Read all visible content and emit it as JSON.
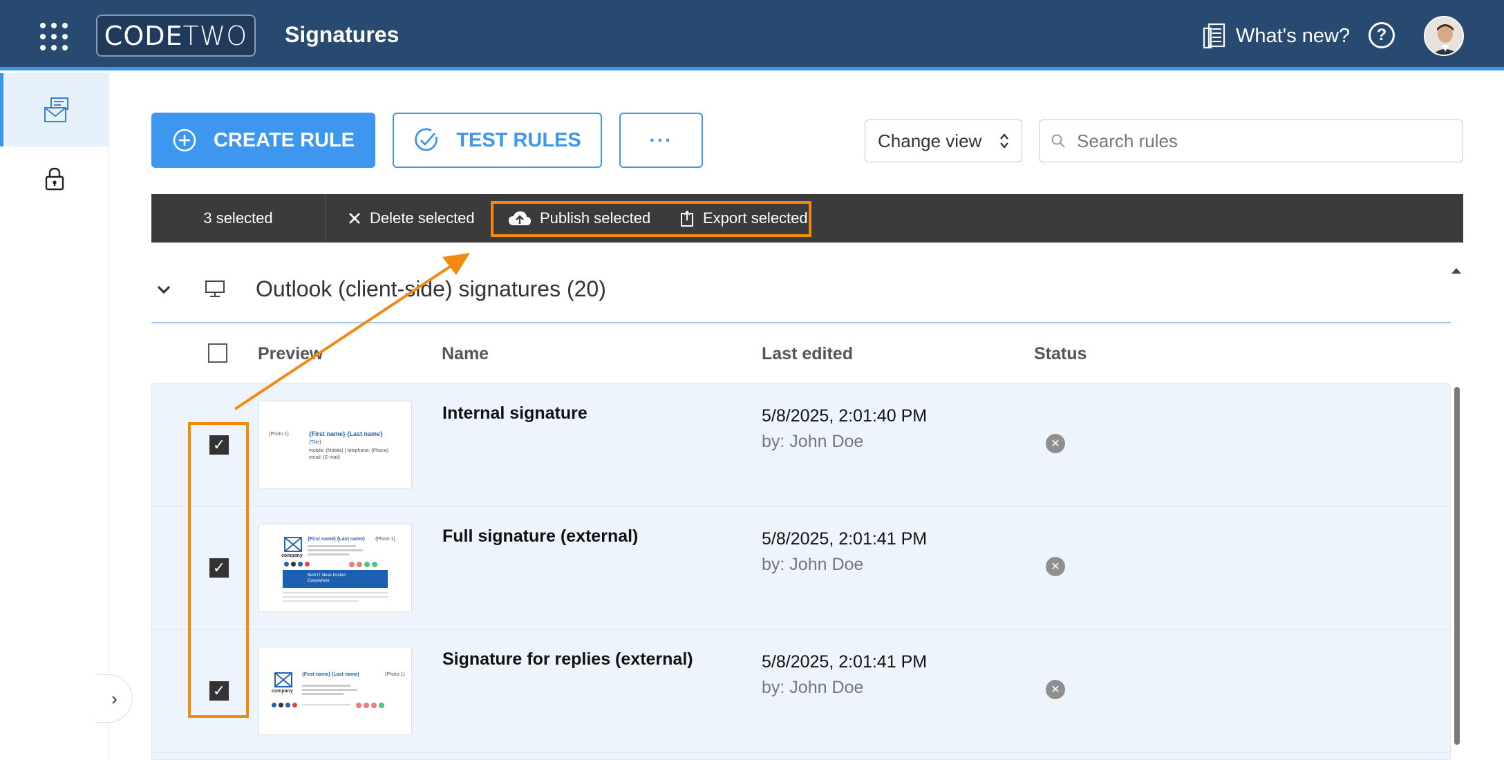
{
  "header": {
    "logo_text_a": "CODE",
    "logo_text_b": "TWO",
    "app_title": "Signatures",
    "whats_new": "What's new?",
    "help": "?"
  },
  "toolbar": {
    "create_rule": "CREATE RULE",
    "test_rules": "TEST RULES",
    "more": "···",
    "change_view": "Change view",
    "search_placeholder": "Search rules"
  },
  "selection_bar": {
    "count": "3 selected",
    "delete": "Delete selected",
    "publish": "Publish selected",
    "export": "Export selected"
  },
  "group": {
    "title": "Outlook (client-side) signatures (20)"
  },
  "columns": {
    "preview": "Preview",
    "name": "Name",
    "last_edited": "Last edited",
    "status": "Status"
  },
  "rows": [
    {
      "name": "Internal signature",
      "edited": "5/8/2025, 2:01:40 PM",
      "by": "by: John Doe",
      "thumb": {
        "photo": "{Photo 1}",
        "name": "{First name} {Last name}",
        "title": "{Title}",
        "mobile": "mobile: {Mobile} | telephone: {Phone}",
        "email": "email: {E-mail}"
      }
    },
    {
      "name": "Full signature (external)",
      "edited": "5/8/2025, 2:01:41 PM",
      "by": "by: John Doe",
      "thumb": {
        "name": "{First name} {Last name}",
        "photo": "{Photo 1}",
        "company": "company",
        "banner": "Best IT ideas trusted Everywhere"
      }
    },
    {
      "name": "Signature for replies (external)",
      "edited": "5/8/2025, 2:01:41 PM",
      "by": "by: John Doe",
      "thumb": {
        "name": "{First name} {Last name}",
        "photo": "{Photo 1}",
        "company": "company"
      }
    }
  ],
  "colors": {
    "header_bg": "#294a70",
    "accent": "#3d97ee",
    "annotation": "#f28a12",
    "selbar_bg": "#3b3b3b",
    "table_bg": "#eef4fb"
  }
}
